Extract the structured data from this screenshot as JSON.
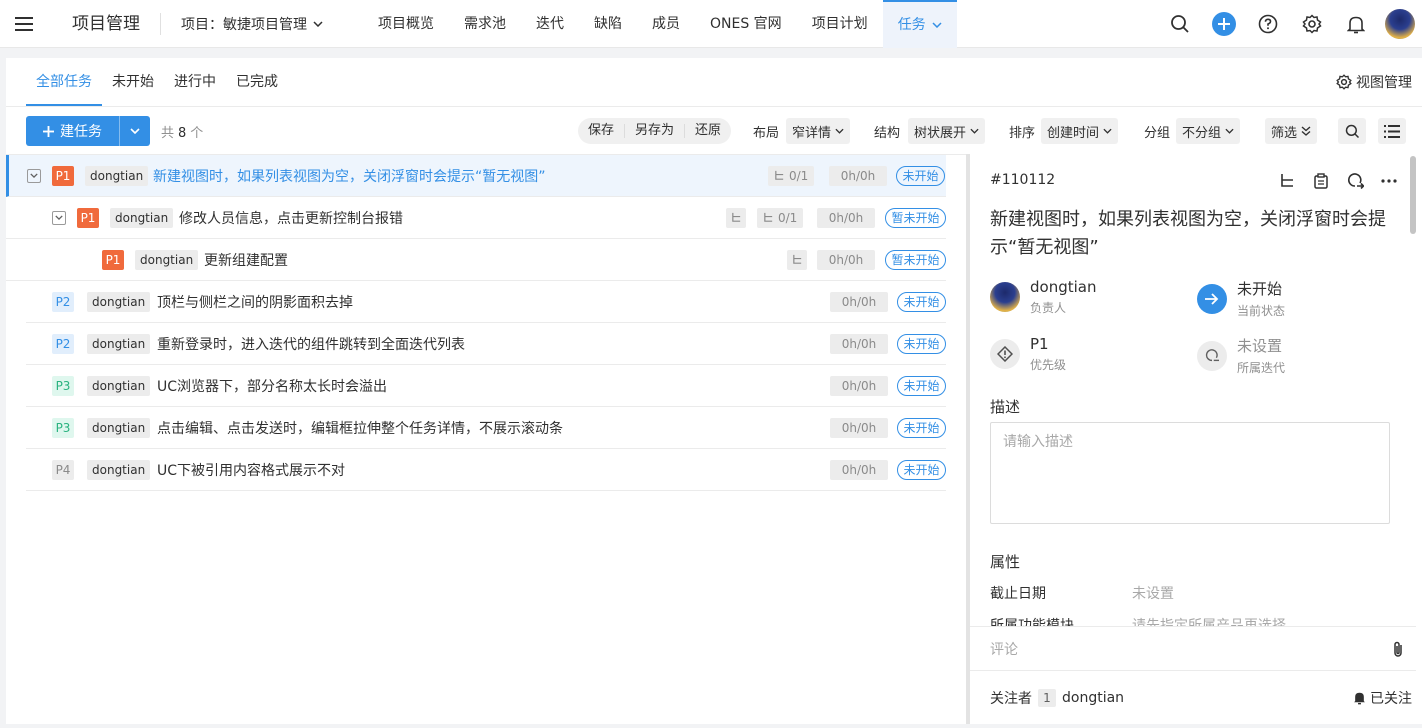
{
  "header": {
    "app_title": "项目管理",
    "project_label": "项目：敏捷项目管理",
    "tabs": [
      {
        "label": "项目概览"
      },
      {
        "label": "需求池"
      },
      {
        "label": "迭代"
      },
      {
        "label": "缺陷"
      },
      {
        "label": "成员"
      },
      {
        "label": "ONES 官网"
      },
      {
        "label": "项目计划"
      },
      {
        "label": "任务"
      }
    ],
    "accent_color": "#338fe5"
  },
  "subtabs": [
    {
      "label": "全部任务"
    },
    {
      "label": "未开始"
    },
    {
      "label": "进行中"
    },
    {
      "label": "已完成"
    }
  ],
  "view_manage": "视图管理",
  "toolbar": {
    "create_label": "建任务",
    "count_prefix": "共",
    "count_value": "8",
    "count_suffix": "个",
    "save": "保存",
    "save_as": "另存为",
    "restore": "还原",
    "layout_label": "布局",
    "layout_value": "窄详情",
    "structure_label": "结构",
    "structure_value": "树状展开",
    "sort_label": "排序",
    "sort_value": "创建时间",
    "group_label": "分组",
    "group_value": "不分组",
    "filter_label": "筛选"
  },
  "tasks": [
    {
      "priority": "P1",
      "owner": "dongtian",
      "title": "新建视图时，如果列表视图为空，关闭浮窗时会提示“暂无视图”",
      "subtasks": "0/1",
      "time": "0h/0h",
      "status": "未开始"
    },
    {
      "priority": "P1",
      "owner": "dongtian",
      "title": "修改人员信息，点击更新控制台报错",
      "subtasks": "0/1",
      "time": "0h/0h",
      "status": "暂未开始"
    },
    {
      "priority": "P1",
      "owner": "dongtian",
      "title": "更新组建配置",
      "time": "0h/0h",
      "status": "暂未开始"
    },
    {
      "priority": "P2",
      "owner": "dongtian",
      "title": "顶栏与侧栏之间的阴影面积去掉",
      "time": "0h/0h",
      "status": "未开始"
    },
    {
      "priority": "P2",
      "owner": "dongtian",
      "title": "重新登录时，进入迭代的组件跳转到全面迭代列表",
      "time": "0h/0h",
      "status": "未开始"
    },
    {
      "priority": "P3",
      "owner": "dongtian",
      "title": "UC浏览器下，部分名称太长时会溢出",
      "time": "0h/0h",
      "status": "未开始"
    },
    {
      "priority": "P3",
      "owner": "dongtian",
      "title": "点击编辑、点击发送时，编辑框拉伸整个任务详情，不展示滚动条",
      "time": "0h/0h",
      "status": "未开始"
    },
    {
      "priority": "P4",
      "owner": "dongtian",
      "title": "UC下被引用内容格式展示不对",
      "time": "0h/0h",
      "status": "未开始"
    }
  ],
  "detail": {
    "id": "#110112",
    "title": "新建视图时，如果列表视图为空，关闭浮窗时会提示“暂无视图”",
    "assignee": "dongtian",
    "assignee_label": "负责人",
    "status": "未开始",
    "status_label": "当前状态",
    "priority": "P1",
    "priority_label": "优先级",
    "sprint": "未设置",
    "sprint_label": "所属迭代",
    "desc_heading": "描述",
    "desc_placeholder": "请输入描述",
    "attr_heading": "属性",
    "attrs": [
      {
        "label": "截止日期",
        "value": "未设置"
      },
      {
        "label": "所属功能模块",
        "value": "请先指定所属产品再选择"
      }
    ],
    "comment_placeholder": "评论",
    "followers_label": "关注者",
    "followers_count": "1",
    "follower_name": "dongtian",
    "followed_label": "已关注"
  }
}
